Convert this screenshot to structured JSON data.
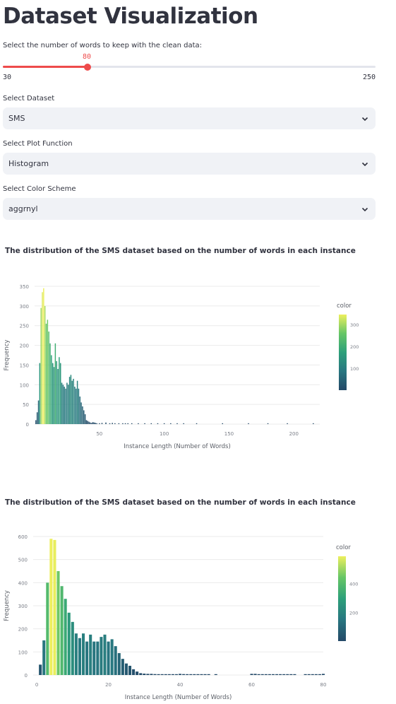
{
  "title": "Dataset Visualization",
  "slider": {
    "label": "Select the number of words to keep with the clean data:",
    "value": 80,
    "value_text": "80",
    "min_text": "30",
    "max_text": "250",
    "min": 30,
    "max": 250
  },
  "selects": {
    "dataset": {
      "label": "Select Dataset",
      "value": "SMS"
    },
    "plot_function": {
      "label": "Select Plot Function",
      "value": "Histogram"
    },
    "color_scheme": {
      "label": "Select Color Scheme",
      "value": "aggrnyl"
    }
  },
  "colors": {
    "accent": "#ee4b4b",
    "select_bg": "#f0f2f6",
    "text": "#31333f"
  },
  "icons": {
    "select_arrow": "chevron-down-icon"
  },
  "chart_data": [
    {
      "type": "bar",
      "title": "The distribution of the SMS dataset based on the number of words in each instance",
      "xlabel": "Instance Length (Number of Words)",
      "ylabel": "Frequency",
      "xlim": [
        0,
        220
      ],
      "ylim": [
        0,
        350
      ],
      "xticks": [
        50,
        100,
        150,
        200
      ],
      "yticks": [
        0,
        50,
        100,
        150,
        200,
        250,
        300,
        350
      ],
      "legend": {
        "title": "color",
        "ticks": [
          100,
          200,
          300
        ],
        "range": [
          1,
          345
        ]
      },
      "x": [
        1,
        2,
        3,
        4,
        5,
        6,
        7,
        8,
        9,
        10,
        11,
        12,
        13,
        14,
        15,
        16,
        17,
        18,
        19,
        20,
        21,
        22,
        23,
        24,
        25,
        26,
        27,
        28,
        29,
        30,
        31,
        32,
        33,
        34,
        35,
        36,
        37,
        38,
        39,
        40,
        41,
        42,
        43,
        44,
        45,
        46,
        47,
        48,
        50,
        52,
        55,
        58,
        60,
        62,
        65,
        68,
        70,
        72,
        75,
        80,
        85,
        90,
        95,
        100,
        105,
        110,
        115,
        125,
        145,
        165,
        180,
        195,
        215
      ],
      "values": [
        10,
        30,
        60,
        155,
        295,
        335,
        345,
        300,
        255,
        265,
        235,
        205,
        175,
        155,
        145,
        205,
        160,
        140,
        170,
        155,
        105,
        100,
        95,
        90,
        105,
        100,
        120,
        125,
        110,
        115,
        95,
        90,
        110,
        90,
        70,
        55,
        45,
        35,
        25,
        10,
        8,
        6,
        4,
        3,
        5,
        4,
        3,
        2,
        2,
        3,
        4,
        2,
        3,
        2,
        2,
        1,
        2,
        1,
        2,
        2,
        1,
        2,
        1,
        1,
        1,
        2,
        1,
        1,
        1,
        1,
        1,
        1,
        1
      ]
    },
    {
      "type": "bar",
      "title": "The distribution of the SMS dataset based on the number of words in each instance",
      "xlabel": "Instance Length (Number of Words)",
      "ylabel": "Frequency",
      "xlim": [
        -1,
        80
      ],
      "ylim": [
        0,
        600
      ],
      "xticks": [
        0,
        20,
        40,
        60,
        80
      ],
      "yticks": [
        0,
        100,
        200,
        300,
        400,
        500,
        600
      ],
      "legend": {
        "title": "color",
        "ticks": [
          200,
          400
        ],
        "range": [
          1,
          590
        ]
      },
      "x": [
        1,
        2,
        3,
        4,
        5,
        6,
        7,
        8,
        9,
        10,
        11,
        12,
        13,
        14,
        15,
        16,
        17,
        18,
        19,
        20,
        21,
        22,
        23,
        24,
        25,
        26,
        27,
        28,
        29,
        30,
        31,
        32,
        33,
        34,
        35,
        36,
        37,
        38,
        39,
        40,
        41,
        42,
        43,
        44,
        45,
        46,
        47,
        48,
        49,
        50,
        51,
        52,
        53,
        54,
        55,
        56,
        57,
        58,
        59,
        60,
        61,
        62,
        63,
        64,
        65,
        66,
        67,
        68,
        69,
        70,
        71,
        72,
        73,
        74,
        75,
        76,
        77,
        78,
        79,
        80
      ],
      "values": [
        45,
        150,
        400,
        590,
        585,
        450,
        385,
        330,
        270,
        230,
        180,
        160,
        180,
        145,
        175,
        145,
        145,
        165,
        175,
        145,
        155,
        125,
        95,
        70,
        50,
        40,
        25,
        15,
        8,
        6,
        5,
        5,
        4,
        3,
        2,
        2,
        1,
        1,
        3,
        5,
        4,
        2,
        1,
        1,
        2,
        2,
        1,
        1,
        0,
        1,
        0,
        0,
        0,
        0,
        0,
        0,
        0,
        0,
        0,
        5,
        5,
        2,
        1,
        1,
        1,
        1,
        1,
        1,
        2,
        2,
        1,
        1,
        0,
        0,
        1,
        1,
        1,
        1,
        2,
        5
      ]
    }
  ]
}
